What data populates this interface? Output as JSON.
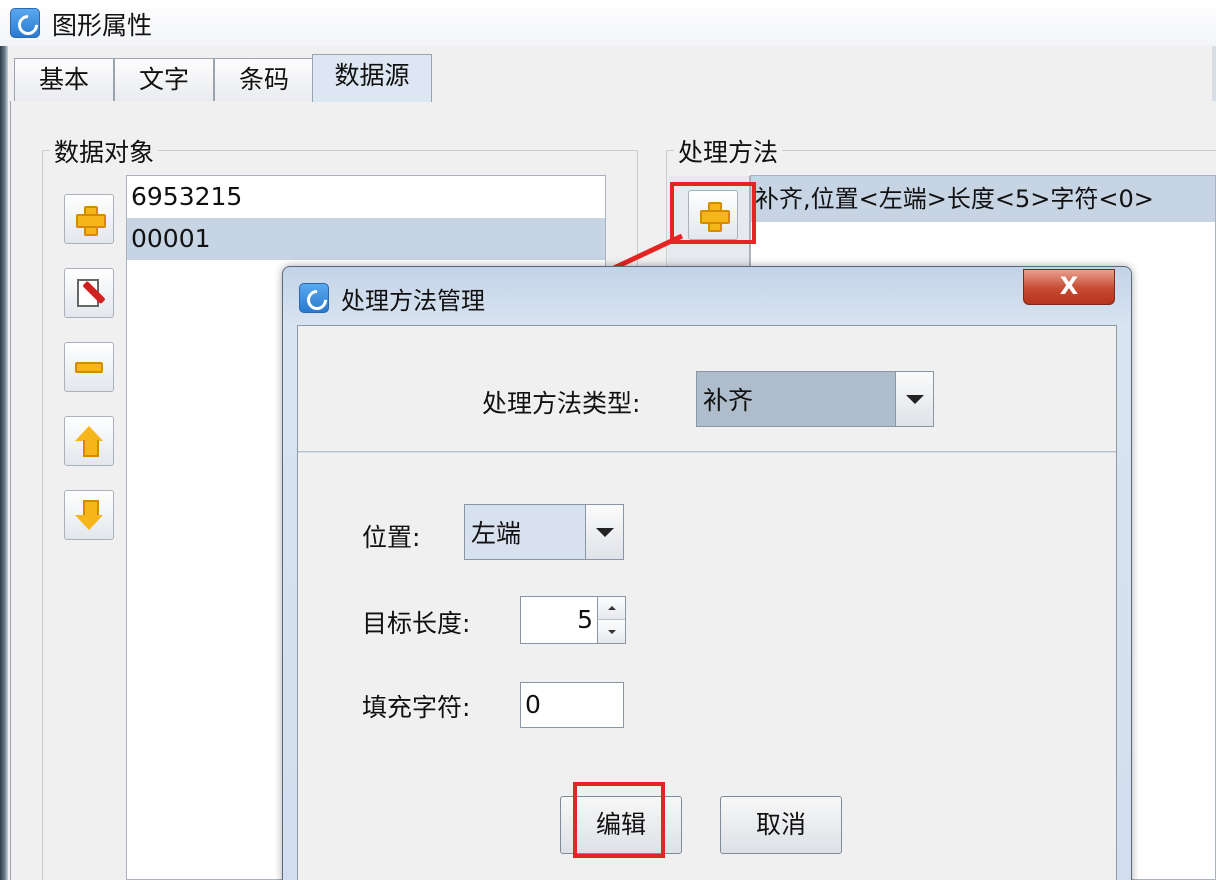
{
  "window": {
    "title": "图形属性"
  },
  "tabs": [
    {
      "label": "基本"
    },
    {
      "label": "文字"
    },
    {
      "label": "条码"
    },
    {
      "label": "数据源",
      "active": true
    }
  ],
  "data_objects": {
    "legend": "数据对象",
    "items": [
      "6953215",
      "00001"
    ],
    "selected_index": 1,
    "buttons": [
      "add-icon",
      "edit-icon",
      "remove-icon",
      "move-up-icon",
      "move-down-icon"
    ]
  },
  "processing": {
    "legend": "处理方法",
    "items": [
      "补齐,位置<左端>长度<5>字符<0>"
    ],
    "add_button_icon": "add-icon"
  },
  "dialog": {
    "title": "处理方法管理",
    "close_label": "X",
    "type_label": "处理方法类型:",
    "type_value": "补齐",
    "position_label": "位置:",
    "position_value": "左端",
    "length_label": "目标长度:",
    "length_value": "5",
    "fill_label": "填充字符:",
    "fill_value": "0",
    "edit_button": "编辑",
    "cancel_button": "取消"
  },
  "colors": {
    "highlight": "#e52424",
    "selection": "#c7d4e4",
    "icon_accent": "#f6b518"
  }
}
